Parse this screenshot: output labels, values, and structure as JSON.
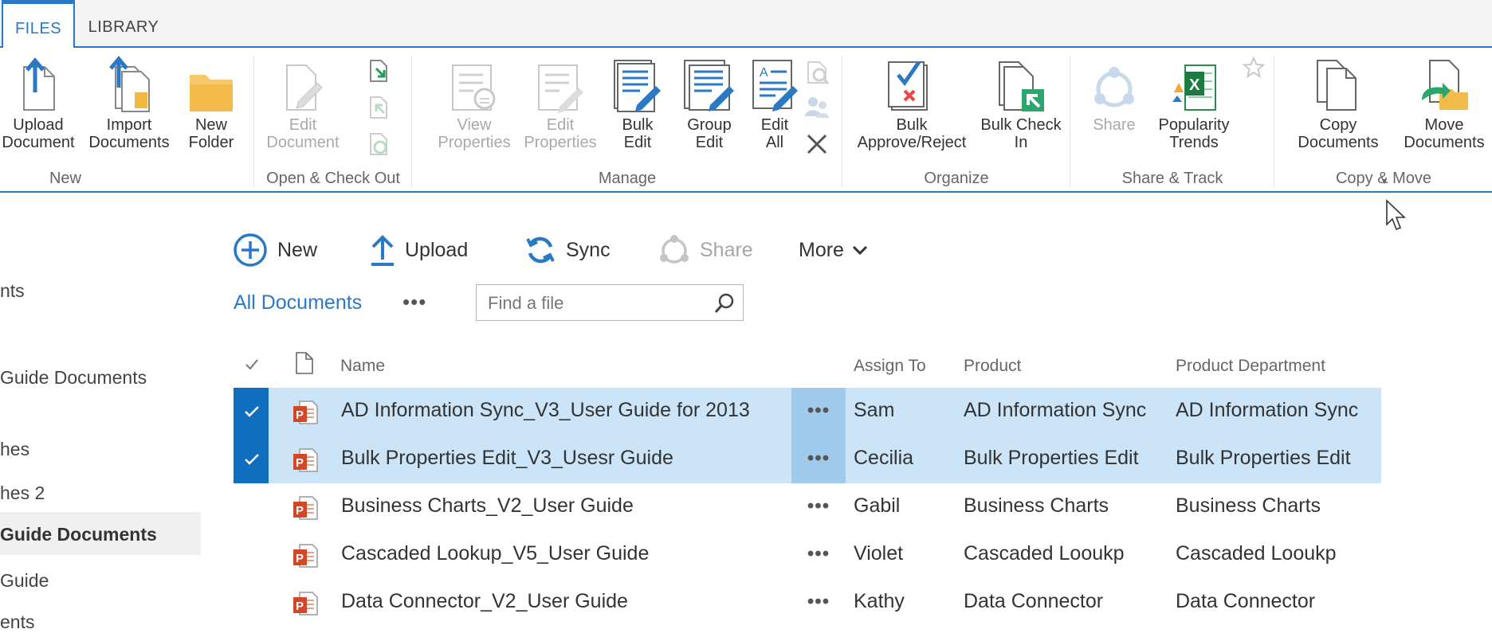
{
  "ribbon": {
    "tabs": [
      {
        "label": "FILES",
        "active": true
      },
      {
        "label": "LIBRARY",
        "active": false
      }
    ],
    "groups": {
      "new": {
        "label": "New",
        "upload_document": "Upload\nDocument",
        "import_documents": "Import\nDocuments",
        "new_folder": "New\nFolder"
      },
      "open": {
        "label": "Open & Check Out",
        "edit_document": "Edit\nDocument"
      },
      "manage": {
        "label": "Manage",
        "view_properties": "View\nProperties",
        "edit_properties": "Edit\nProperties",
        "bulk_edit": "Bulk\nEdit",
        "group_edit": "Group\nEdit",
        "edit_all": "Edit\nAll"
      },
      "organize": {
        "label": "Organize",
        "bulk_approve": "Bulk\nApprove/Reject",
        "bulk_checkin": "Bulk Check\nIn"
      },
      "share": {
        "label": "Share & Track",
        "share": "Share",
        "popularity": "Popularity\nTrends"
      },
      "copy": {
        "label": "Copy & Move",
        "copy_documents": "Copy\nDocuments",
        "move_documents": "Move\nDocuments"
      }
    }
  },
  "commands": {
    "new": "New",
    "upload": "Upload",
    "sync": "Sync",
    "share": "Share",
    "more": "More"
  },
  "nav": {
    "items": [
      "nts",
      "Guide Documents",
      "hes",
      "hes 2",
      "Guide Documents",
      "Guide",
      "ents"
    ]
  },
  "view": {
    "all_documents": "All Documents",
    "dots": "•••",
    "search_placeholder": "Find a file"
  },
  "table": {
    "headers": {
      "name": "Name",
      "assign_to": "Assign To",
      "product": "Product",
      "department": "Product Department"
    },
    "ellipsis": "•••",
    "rows": [
      {
        "name": "AD Information Sync_V3_User Guide for 2013",
        "assign_to": "Sam",
        "product": "AD Information Sync",
        "department": "AD Information Sync",
        "selected": true
      },
      {
        "name": "Bulk Properties Edit_V3_Usesr Guide",
        "assign_to": "Cecilia",
        "product": "Bulk Properties Edit",
        "department": "Bulk Properties Edit",
        "selected": true
      },
      {
        "name": "Business Charts_V2_User Guide",
        "assign_to": "Gabil",
        "product": "Business Charts",
        "department": "Business Charts",
        "selected": false
      },
      {
        "name": "Cascaded Lookup_V5_User Guide",
        "assign_to": "Violet",
        "product": "Cascaded Looukp",
        "department": "Cascaded Looukp",
        "selected": false
      },
      {
        "name": "Data Connector_V2_User Guide",
        "assign_to": "Kathy",
        "product": "Data Connector",
        "department": "Data Connector",
        "selected": false
      }
    ]
  },
  "colors": {
    "accent": "#2b78c5",
    "selection_row": "#cce4f7",
    "selection_check": "#106ebe",
    "disabled": "#a9a9a9"
  }
}
